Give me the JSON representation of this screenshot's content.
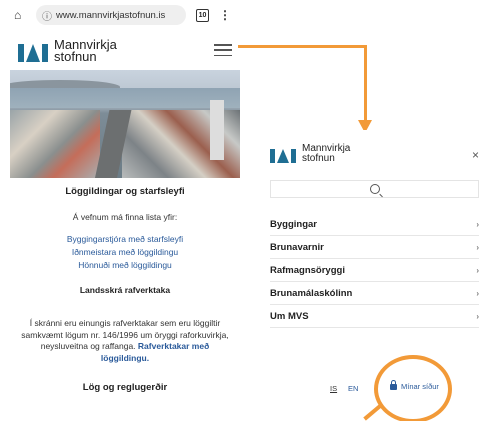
{
  "browser": {
    "url": "www.mannvirkjastofnun.is",
    "tab_count": "10",
    "home_icon": "home-icon",
    "menu_icon": "kebab-icon"
  },
  "site": {
    "logo_line1": "Mannvirkja",
    "logo_line2": "stofnun",
    "brand_color": "#1f6e93"
  },
  "content": {
    "heading1": "Löggildingar og starfsleyfi",
    "intro": "Á vefnum má finna lista yfir:",
    "links": [
      "Byggingarstjóra með starfsleyfi",
      "Iðnmeistara með löggildingu",
      "Hönnuði með löggildingu"
    ],
    "heading2": "Landsskrá rafverktaka",
    "paragraph": "Í skránni eru einungis rafverktakar sem eru löggiltir samkvæmt lögum nr. 146/1996 um öryggi raforkuvirkja, neysluveitna og raffanga.",
    "paragraph_link": "Rafverktakar með löggildingu.",
    "heading3": "Lög og reglugerðir"
  },
  "menu": {
    "logo_line1": "Mannvirkja",
    "logo_line2": "stofnun",
    "close_label": "×",
    "items": [
      "Byggingar",
      "Brunavarnir",
      "Rafmagnsöryggi",
      "Brunamálaskólinn",
      "Um MVS"
    ],
    "lang_is": "IS",
    "lang_en": "EN",
    "my_pages": "Mínar síður"
  },
  "annotation_color": "#f29a38"
}
